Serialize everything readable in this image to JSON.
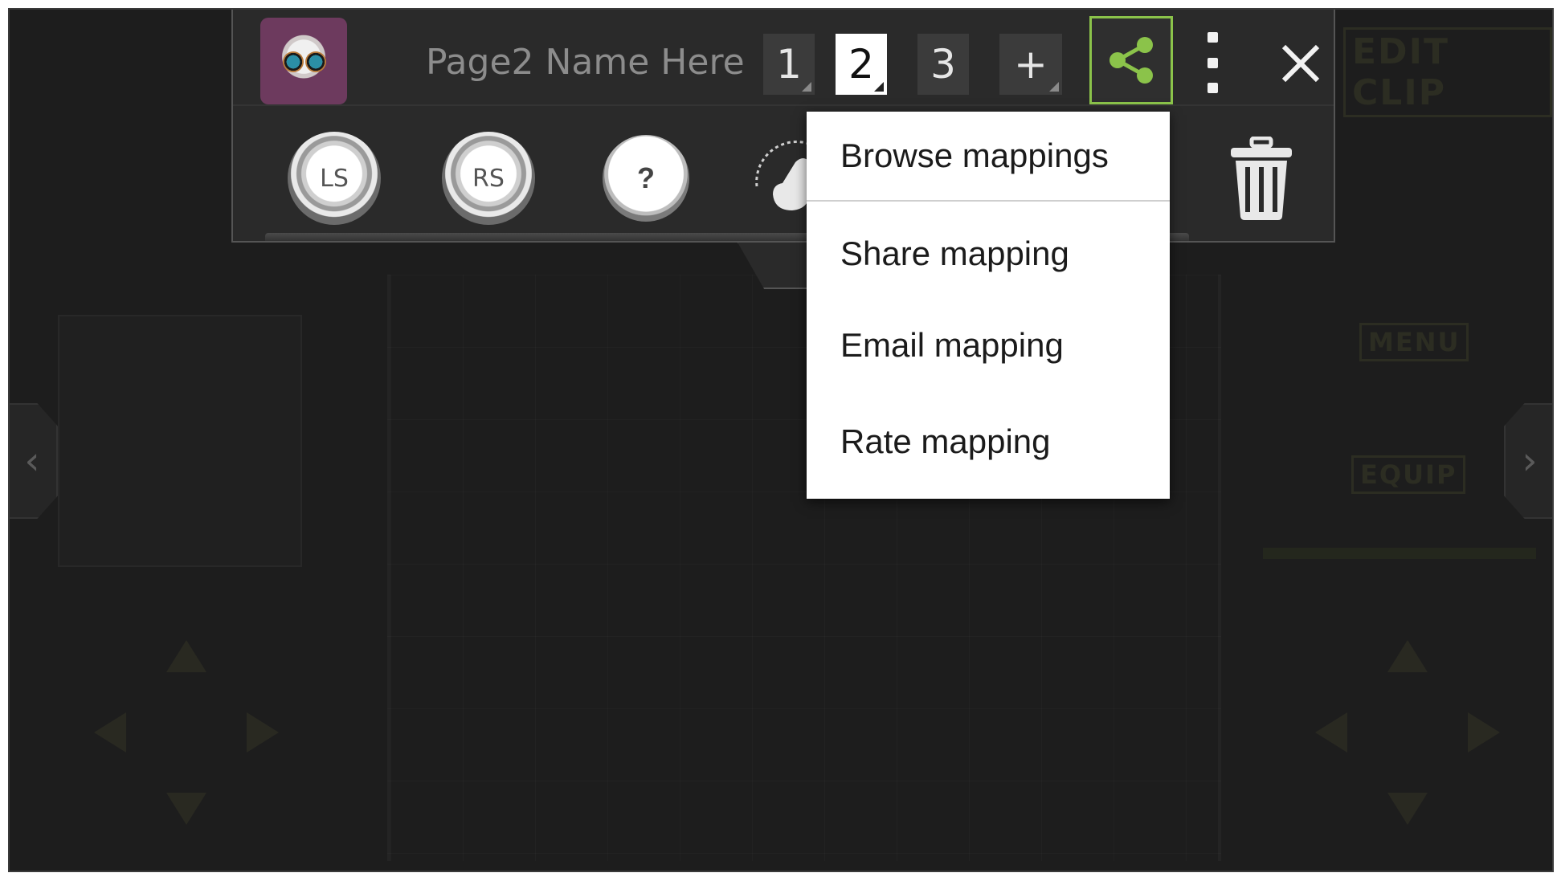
{
  "toolbar": {
    "page_name": "Page2 Name Here",
    "pages": [
      {
        "label": "1",
        "active": false
      },
      {
        "label": "2",
        "active": true
      },
      {
        "label": "3",
        "active": false
      }
    ],
    "add_label": "+",
    "accent_color": "#8bc34a"
  },
  "controls": {
    "ls_label": "LS",
    "rs_label": "RS",
    "help_label": "?"
  },
  "share_menu": {
    "items": [
      "Browse mappings",
      "Share mapping",
      "Email mapping",
      "Rate mapping"
    ]
  },
  "background": {
    "words": [
      "EDIT CLIP",
      "MENU",
      "EQUIP"
    ]
  },
  "icons": {
    "share": "share-icon",
    "overflow": "more-vertical-icon",
    "close": "close-icon",
    "trash": "trash-icon",
    "gesture": "tap-gesture-icon",
    "nav_left": "chevron-left-icon",
    "nav_right": "chevron-right-icon"
  }
}
